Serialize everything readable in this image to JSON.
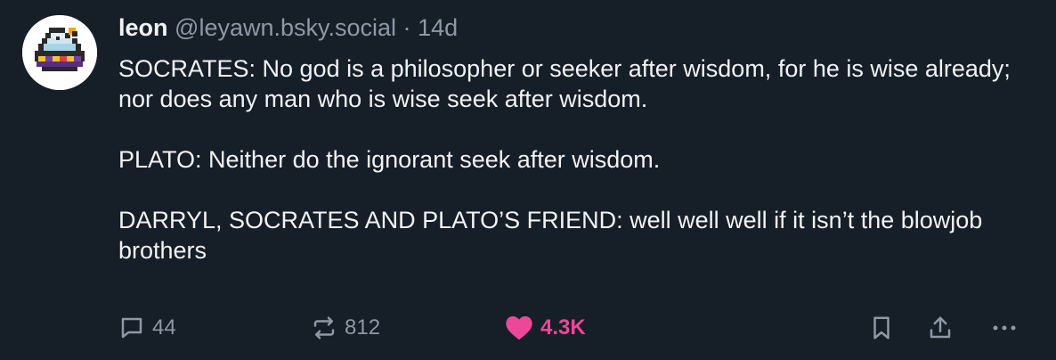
{
  "post": {
    "author": {
      "display_name": "leon",
      "handle": "@leyawn.bsky.social",
      "avatar_icon": "pixel-art-avatar-icon"
    },
    "separator": "·",
    "timestamp": "14d",
    "text_paragraphs": [
      "SOCRATES: No god is a philosopher or seeker after wisdom, for he is wise already; nor does any man who is wise seek after wisdom.",
      "PLATO: Neither do the ignorant seek after wisdom.",
      "DARRYL, SOCRATES AND PLATO’S FRIEND: well well well if it isn’t the blowjob brothers"
    ]
  },
  "actions": {
    "reply": {
      "icon": "reply-bubble-icon",
      "count": "44"
    },
    "repost": {
      "icon": "repost-icon",
      "count": "812"
    },
    "like": {
      "icon": "heart-icon",
      "count": "4.3K",
      "liked": true,
      "color": "#ec4899"
    },
    "bookmark": {
      "icon": "bookmark-icon"
    },
    "share": {
      "icon": "share-icon"
    },
    "more": {
      "icon": "more-options-icon"
    }
  },
  "colors": {
    "background": "#161e27",
    "text": "#f1f3f5",
    "muted": "#8d99a6",
    "like": "#ec4899"
  }
}
